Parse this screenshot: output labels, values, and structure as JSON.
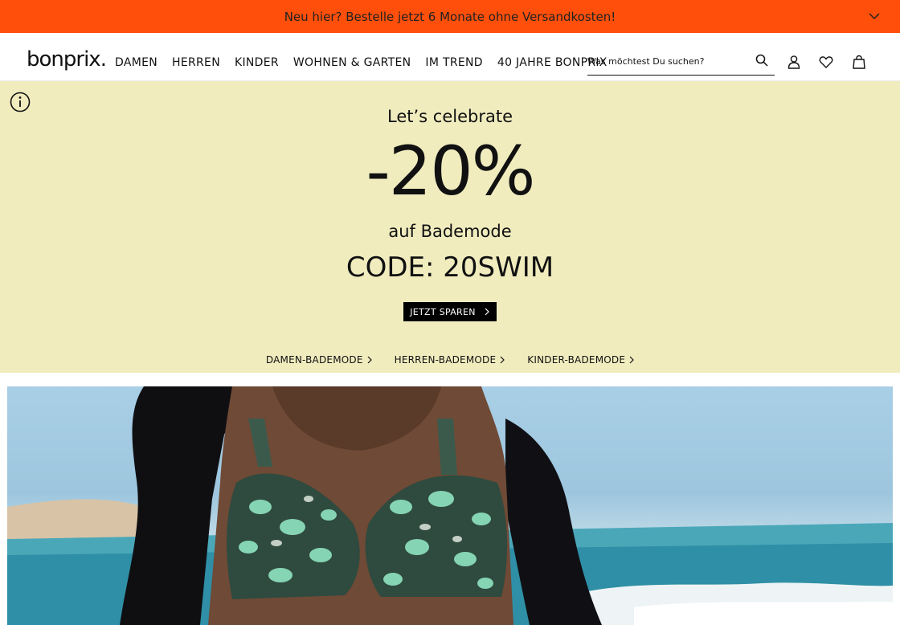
{
  "promo": {
    "text": "Neu hier? Bestelle jetzt 6 Monate ohne Versandkosten!",
    "background": "#ff4f0a",
    "toggle_icon": "chevron-down-icon"
  },
  "header": {
    "logo": "bonprix.",
    "nav": [
      "DAMEN",
      "HERREN",
      "KINDER",
      "WOHNEN & GARTEN",
      "IM TREND",
      "40 JAHRE BONPRIX"
    ],
    "search": {
      "placeholder": "Was möchtest Du suchen?",
      "icon": "search-icon"
    },
    "icons": [
      "user-icon",
      "heart-icon",
      "shopping-bag-icon"
    ]
  },
  "hero": {
    "background": "#f0ecbe",
    "info_icon": "info-icon",
    "line1": "Let’s celebrate",
    "discount": "-20%",
    "line2": "auf Bademode",
    "code": "CODE: 20SWIM",
    "cta": "JETZT SPAREN",
    "links": [
      "DAMEN-BADEMODE",
      "HERREN-BADEMODE",
      "KINDER-BADEMODE"
    ]
  }
}
